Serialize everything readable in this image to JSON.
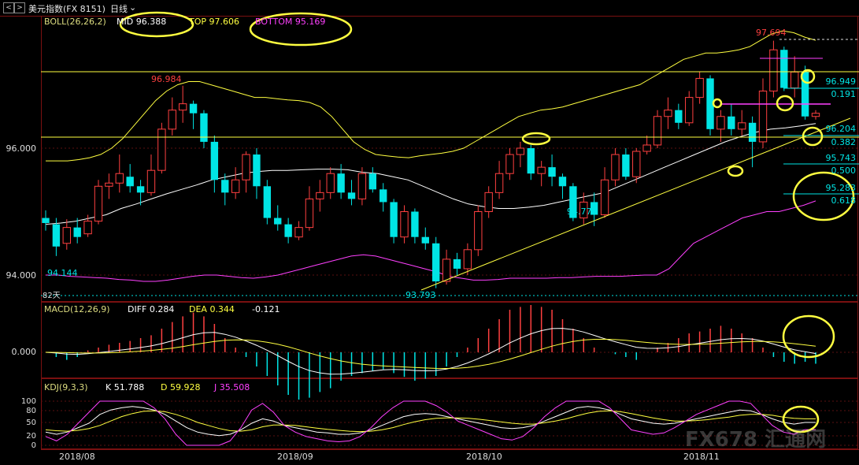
{
  "window": {
    "nav_prev": "<",
    "nav_next": ">",
    "title": "美元指数(FX 8151)",
    "period": "日线",
    "period_arrow": "⌄"
  },
  "colors": {
    "up": "#ff4040",
    "down": "#00e5e5",
    "yellow": "#ffff40",
    "magenta": "#ff40ff",
    "white": "#ffffff",
    "axis": "#7a1010"
  },
  "chart_data": [
    {
      "type": "candlestick",
      "indicator": "BOLL(26,26,2)",
      "legend": {
        "name": "BOLL(26,26,2)",
        "mid": "MID 96.388",
        "top": "TOP 97.606",
        "bottom": "BOTTOM 95.169"
      },
      "y_ticks": [
        "96.000",
        "94.000"
      ],
      "x_labels": [
        "2018/08",
        "2018/09",
        "2018/10",
        "2018/11"
      ],
      "annotations": {
        "high1": "96.984",
        "low1": "94.144",
        "low2": "93.793",
        "low3": "94.772",
        "high2": "97.694",
        "days": "82天"
      },
      "fib_levels": [
        {
          "price": "96.949",
          "ratio": "0.191"
        },
        {
          "price": "96.204",
          "ratio": "0.382"
        },
        {
          "price": "95.743",
          "ratio": "0.500"
        },
        {
          "price": "95.283",
          "ratio": "0.618"
        }
      ],
      "ylim": [
        93.6,
        98.0
      ],
      "candles": [
        [
          94.9,
          94.82,
          95.02,
          94.7
        ],
        [
          94.8,
          94.45,
          94.9,
          94.3
        ],
        [
          94.5,
          94.75,
          94.88,
          94.4
        ],
        [
          94.75,
          94.6,
          94.9,
          94.5
        ],
        [
          94.65,
          94.85,
          94.95,
          94.6
        ],
        [
          94.85,
          95.4,
          95.5,
          94.8
        ],
        [
          95.4,
          95.45,
          95.6,
          95.2
        ],
        [
          95.45,
          95.6,
          95.9,
          95.3
        ],
        [
          95.55,
          95.4,
          95.75,
          95.3
        ],
        [
          95.4,
          95.3,
          95.5,
          95.1
        ],
        [
          95.3,
          95.65,
          95.9,
          95.25
        ],
        [
          95.65,
          96.3,
          96.4,
          95.6
        ],
        [
          96.3,
          96.6,
          96.8,
          96.2
        ],
        [
          96.6,
          96.7,
          96.984,
          96.4
        ],
        [
          96.7,
          96.55,
          96.75,
          96.3
        ],
        [
          96.55,
          96.1,
          96.6,
          96.0
        ],
        [
          96.1,
          95.5,
          96.2,
          95.3
        ],
        [
          95.5,
          95.3,
          95.6,
          95.1
        ],
        [
          95.3,
          95.5,
          95.7,
          95.2
        ],
        [
          95.5,
          95.9,
          95.95,
          95.3
        ],
        [
          95.9,
          95.4,
          96.0,
          95.2
        ],
        [
          95.4,
          94.9,
          95.5,
          94.8
        ],
        [
          94.9,
          94.8,
          95.1,
          94.7
        ],
        [
          94.8,
          94.6,
          94.9,
          94.5
        ],
        [
          94.6,
          94.75,
          94.85,
          94.55
        ],
        [
          94.75,
          95.2,
          95.4,
          94.7
        ],
        [
          95.2,
          95.3,
          95.5,
          95.0
        ],
        [
          95.3,
          95.6,
          95.7,
          95.2
        ],
        [
          95.6,
          95.3,
          95.75,
          95.2
        ],
        [
          95.3,
          95.2,
          95.5,
          95.1
        ],
        [
          95.2,
          95.6,
          95.7,
          95.1
        ],
        [
          95.6,
          95.35,
          95.7,
          95.3
        ],
        [
          95.35,
          95.15,
          95.45,
          95.0
        ],
        [
          95.15,
          94.6,
          95.2,
          94.5
        ],
        [
          94.6,
          95.0,
          95.1,
          94.5
        ],
        [
          95.0,
          94.6,
          95.05,
          94.5
        ],
        [
          94.6,
          94.5,
          94.75,
          94.4
        ],
        [
          94.5,
          93.9,
          94.6,
          93.793
        ],
        [
          93.9,
          94.25,
          94.4,
          93.85
        ],
        [
          94.25,
          94.1,
          94.35,
          94.0
        ],
        [
          94.1,
          94.4,
          94.5,
          94.0
        ],
        [
          94.4,
          95.0,
          95.1,
          94.3
        ],
        [
          95.0,
          95.3,
          95.4,
          94.9
        ],
        [
          95.3,
          95.6,
          95.8,
          95.2
        ],
        [
          95.6,
          95.9,
          96.0,
          95.5
        ],
        [
          95.9,
          96.0,
          96.1,
          95.7
        ],
        [
          96.0,
          95.6,
          96.05,
          95.5
        ],
        [
          95.6,
          95.7,
          95.8,
          95.4
        ],
        [
          95.7,
          95.55,
          95.9,
          95.4
        ],
        [
          95.55,
          95.4,
          95.6,
          95.2
        ],
        [
          95.4,
          94.9,
          95.45,
          94.85
        ],
        [
          94.9,
          95.15,
          95.3,
          94.8
        ],
        [
          95.15,
          94.95,
          95.3,
          94.772
        ],
        [
          94.95,
          95.5,
          95.7,
          94.9
        ],
        [
          95.5,
          95.9,
          96.0,
          95.4
        ],
        [
          95.9,
          95.55,
          96.0,
          95.5
        ],
        [
          95.55,
          95.95,
          96.0,
          95.45
        ],
        [
          95.95,
          96.05,
          96.2,
          95.9
        ],
        [
          96.05,
          96.5,
          96.6,
          96.0
        ],
        [
          96.5,
          96.6,
          96.8,
          96.3
        ],
        [
          96.6,
          96.4,
          96.7,
          96.3
        ],
        [
          96.4,
          96.8,
          96.9,
          96.35
        ],
        [
          96.8,
          97.1,
          97.2,
          96.7
        ],
        [
          97.1,
          96.3,
          97.15,
          96.2
        ],
        [
          96.3,
          96.5,
          96.6,
          96.1
        ],
        [
          96.5,
          96.3,
          96.7,
          96.2
        ],
        [
          96.3,
          96.4,
          96.6,
          96.2
        ],
        [
          96.4,
          96.1,
          96.5,
          95.7
        ],
        [
          96.1,
          96.9,
          97.1,
          96.0
        ],
        [
          96.9,
          97.55,
          97.694,
          96.8
        ],
        [
          97.55,
          96.95,
          97.6,
          96.9
        ],
        [
          96.95,
          97.2,
          97.45,
          96.8
        ],
        [
          97.2,
          96.5,
          97.3,
          96.45
        ],
        [
          96.5,
          96.55,
          96.6,
          96.45
        ]
      ],
      "series": [
        {
          "name": "BOLL UPPER",
          "values": [
            95.8,
            95.8,
            95.8,
            95.82,
            95.85,
            95.9,
            96.0,
            96.15,
            96.35,
            96.55,
            96.75,
            96.9,
            97.0,
            97.05,
            97.05,
            97.0,
            96.95,
            96.9,
            96.85,
            96.8,
            96.8,
            96.78,
            96.76,
            96.75,
            96.72,
            96.65,
            96.5,
            96.3,
            96.1,
            95.98,
            95.9,
            95.88,
            95.86,
            95.85,
            95.88,
            95.9,
            95.92,
            95.95,
            96.0,
            96.1,
            96.2,
            96.3,
            96.4,
            96.5,
            96.55,
            96.6,
            96.62,
            96.65,
            96.7,
            96.75,
            96.8,
            96.85,
            96.9,
            96.95,
            97.0,
            97.1,
            97.2,
            97.3,
            97.4,
            97.45,
            97.5,
            97.5,
            97.52,
            97.55,
            97.6,
            97.7,
            97.8,
            97.85,
            97.82,
            97.75,
            97.7
          ]
        },
        {
          "name": "BOLL MID",
          "values": [
            94.8,
            94.82,
            94.85,
            94.9,
            94.95,
            95.05,
            95.12,
            95.2,
            95.28,
            95.35,
            95.42,
            95.5,
            95.55,
            95.6,
            95.63,
            95.65,
            95.65,
            95.66,
            95.67,
            95.67,
            95.66,
            95.62,
            95.6,
            95.55,
            95.5,
            95.4,
            95.3,
            95.2,
            95.12,
            95.08,
            95.05,
            95.05,
            95.07,
            95.1,
            95.15,
            95.2,
            95.25,
            95.3,
            95.4,
            95.5,
            95.6,
            95.7,
            95.8,
            95.9,
            96.0,
            96.1,
            96.18,
            96.25,
            96.3,
            96.32,
            96.35,
            96.388
          ]
        },
        {
          "name": "BOLL LOWER",
          "values": [
            94.0,
            94.0,
            93.98,
            93.97,
            93.96,
            93.95,
            93.93,
            93.92,
            93.9,
            93.9,
            93.92,
            93.95,
            93.98,
            94.0,
            94.0,
            93.98,
            93.96,
            93.95,
            93.97,
            94.0,
            94.05,
            94.1,
            94.15,
            94.2,
            94.25,
            94.3,
            94.32,
            94.3,
            94.25,
            94.2,
            94.15,
            94.1,
            94.05,
            93.98,
            93.95,
            93.92,
            93.92,
            93.93,
            93.95,
            93.95,
            93.95,
            93.95,
            93.96,
            93.96,
            93.97,
            93.98,
            93.98,
            93.98,
            93.99,
            94.0,
            94.0,
            94.1,
            94.3,
            94.5,
            94.6,
            94.7,
            94.8,
            94.9,
            94.95,
            95.0,
            95.0,
            95.05,
            95.1,
            95.169
          ]
        }
      ]
    },
    {
      "type": "bar",
      "indicator": "MACD(12,26,9)",
      "legend": {
        "name": "MACD(12,26,9)",
        "diff": "DIFF 0.284",
        "dea": "DEA 0.344",
        "macd": "-0.121"
      },
      "y_ticks": [
        "0.000"
      ],
      "ylim": [
        -0.7,
        0.8
      ],
      "values": [
        0.0,
        -0.05,
        -0.08,
        -0.05,
        0.02,
        0.05,
        0.08,
        0.1,
        0.12,
        0.15,
        0.18,
        0.25,
        0.32,
        0.38,
        0.42,
        0.38,
        0.3,
        0.15,
        0.05,
        -0.05,
        -0.15,
        -0.25,
        -0.35,
        -0.45,
        -0.5,
        -0.48,
        -0.42,
        -0.38,
        -0.3,
        -0.25,
        -0.22,
        -0.2,
        -0.18,
        -0.22,
        -0.26,
        -0.3,
        -0.28,
        -0.25,
        -0.15,
        -0.05,
        0.05,
        0.15,
        0.25,
        0.35,
        0.45,
        0.48,
        0.5,
        0.48,
        0.45,
        0.35,
        0.25,
        0.15,
        0.05,
        0.0,
        -0.02,
        -0.05,
        -0.08,
        0.0,
        0.05,
        0.1,
        0.15,
        0.2,
        0.22,
        0.25,
        0.28,
        0.25,
        0.2,
        0.15,
        0.05,
        -0.05,
        -0.1,
        -0.121,
        -0.1,
        -0.121
      ]
    },
    {
      "type": "line",
      "indicator": "KDJ(9,3,3)",
      "legend": {
        "name": "KDJ(9,3,3)",
        "k": "K 51.788",
        "d": "D 59.928",
        "j": "J 35.508"
      },
      "y_ticks": [
        "100",
        "80",
        "50",
        "20",
        "0"
      ],
      "ylim": [
        0,
        100
      ],
      "series": [
        {
          "name": "K",
          "values": [
            30,
            25,
            30,
            40,
            50,
            70,
            80,
            85,
            88,
            85,
            80,
            70,
            55,
            40,
            30,
            25,
            22,
            25,
            35,
            50,
            60,
            55,
            45,
            40,
            35,
            30,
            28,
            25,
            25,
            28,
            35,
            45,
            55,
            65,
            70,
            72,
            70,
            65,
            60,
            55,
            50,
            45,
            40,
            38,
            40,
            45,
            55,
            65,
            75,
            85,
            88,
            85,
            80,
            70,
            60,
            55,
            50,
            48,
            50,
            55,
            60,
            65,
            70,
            75,
            80,
            78,
            70,
            60,
            52,
            48,
            51.788,
            51.788
          ]
        },
        {
          "name": "D",
          "values": [
            35,
            33,
            32,
            34,
            38,
            45,
            55,
            65,
            72,
            77,
            78,
            76,
            70,
            62,
            52,
            45,
            38,
            33,
            32,
            35,
            42,
            46,
            46,
            45,
            42,
            39,
            36,
            34,
            32,
            31,
            32,
            35,
            40,
            47,
            53,
            58,
            61,
            62,
            62,
            61,
            59,
            56,
            53,
            50,
            48,
            48,
            51,
            55,
            60,
            67,
            73,
            77,
            78,
            76,
            72,
            67,
            62,
            58,
            55,
            55,
            56,
            58,
            61,
            64,
            68,
            70,
            70,
            68,
            64,
            61,
            59.928,
            59.928
          ]
        },
        {
          "name": "J",
          "values": [
            20,
            10,
            25,
            50,
            75,
            100,
            100,
            100,
            100,
            100,
            85,
            60,
            25,
            0,
            0,
            0,
            0,
            10,
            40,
            80,
            95,
            75,
            45,
            30,
            20,
            15,
            10,
            8,
            10,
            20,
            40,
            65,
            85,
            100,
            100,
            100,
            90,
            75,
            55,
            45,
            35,
            25,
            15,
            12,
            20,
            40,
            65,
            85,
            100,
            100,
            100,
            100,
            85,
            60,
            35,
            30,
            25,
            28,
            40,
            55,
            70,
            80,
            90,
            100,
            100,
            95,
            70,
            45,
            30,
            25,
            35.508,
            35.508
          ]
        }
      ]
    }
  ],
  "watermark": "FX678 汇通网"
}
